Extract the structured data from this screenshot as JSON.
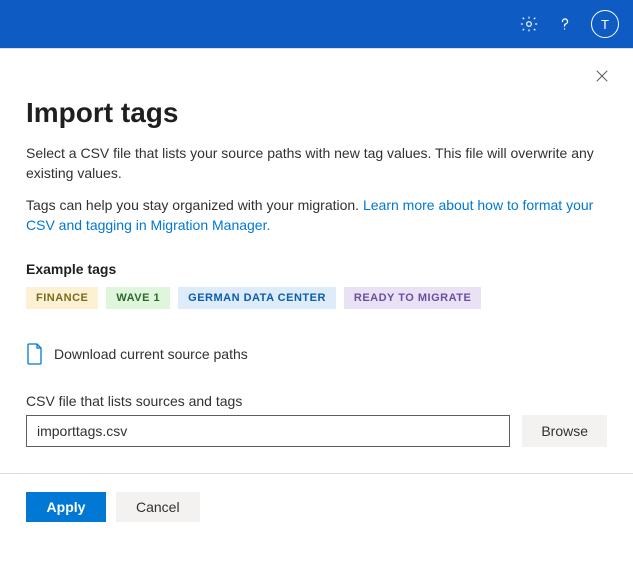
{
  "topbar": {
    "avatar_initial": "T"
  },
  "panel": {
    "title": "Import tags",
    "description": "Select a CSV file that lists your source paths with new tag values. This file will overwrite any existing values.",
    "subdescription_prefix": "Tags can help you stay organized with your migration. ",
    "link_text": "Learn more about how to format your CSV and tagging in Migration Manager."
  },
  "example": {
    "label": "Example tags",
    "tags": [
      {
        "text": "FINANCE",
        "bg": "#fcf2d3",
        "fg": "#7a6a1f"
      },
      {
        "text": "WAVE 1",
        "bg": "#dff6dd",
        "fg": "#2b6a2b"
      },
      {
        "text": "GERMAN DATA CENTER",
        "bg": "#deecf9",
        "fg": "#0b5cad"
      },
      {
        "text": "READY TO MIGRATE",
        "bg": "#e9e2f4",
        "fg": "#6b4ea0"
      }
    ]
  },
  "download": {
    "label": "Download current source paths"
  },
  "file": {
    "label": "CSV file that lists sources and tags",
    "value": "importtags.csv",
    "browse": "Browse"
  },
  "footer": {
    "apply": "Apply",
    "cancel": "Cancel"
  }
}
